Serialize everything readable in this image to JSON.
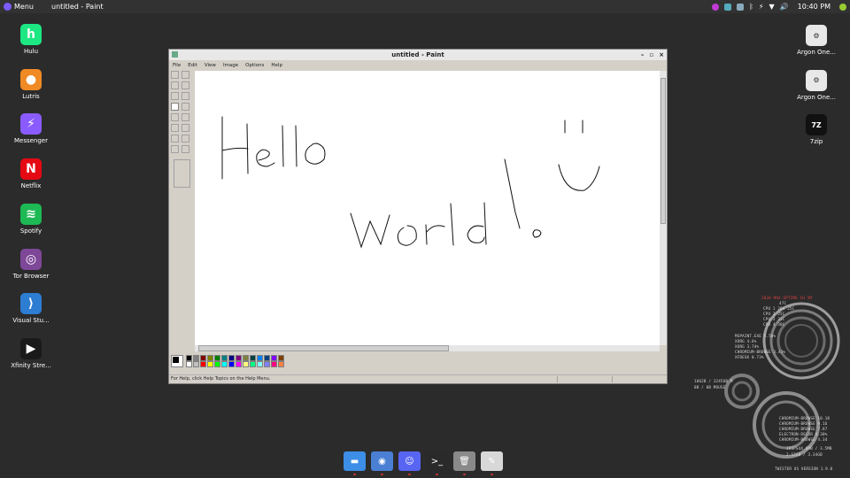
{
  "top_panel": {
    "menu_label": "Menu",
    "window_title": "untitled - Paint",
    "clock": "10:40 PM"
  },
  "desktop_left": [
    {
      "label": "Hulu",
      "icon": "hulu-icon",
      "color": "#1ce783",
      "glyph": "h"
    },
    {
      "label": "Lutris",
      "icon": "lutris-icon",
      "color": "#f08a24",
      "glyph": "●"
    },
    {
      "label": "Messenger",
      "icon": "messenger-icon",
      "color": "#8a5cff",
      "glyph": "⚡"
    },
    {
      "label": "Netflix",
      "icon": "netflix-icon",
      "color": "#e50914",
      "glyph": "N"
    },
    {
      "label": "Spotify",
      "icon": "spotify-icon",
      "color": "#1db954",
      "glyph": "≋"
    },
    {
      "label": "Tor Browser",
      "icon": "tor-icon",
      "color": "#7e4798",
      "glyph": "◎"
    },
    {
      "label": "Visual Stu...",
      "icon": "vscode-icon",
      "color": "#2d7dd2",
      "glyph": "⟩"
    },
    {
      "label": "Xfinity Stre...",
      "icon": "xfinity-icon",
      "color": "#1a1a1a",
      "glyph": "▶"
    }
  ],
  "desktop_right": [
    {
      "label": "Argon One...",
      "icon": "script-icon"
    },
    {
      "label": "Argon One...",
      "icon": "script-icon"
    },
    {
      "label": "7zip",
      "icon": "7zip-icon",
      "glyph": "7Z"
    }
  ],
  "paint": {
    "title": "untitled - Paint",
    "menus": [
      "File",
      "Edit",
      "View",
      "Image",
      "Options",
      "Help"
    ],
    "status_text": "For Help, click Help Topics on the Help Menu.",
    "palette_colors": [
      "#000000",
      "#808080",
      "#800000",
      "#808000",
      "#008000",
      "#008080",
      "#000080",
      "#800080",
      "#808040",
      "#004040",
      "#0080ff",
      "#004080",
      "#8000ff",
      "#804000",
      "#ffffff",
      "#c0c0c0",
      "#ff0000",
      "#ffff00",
      "#00ff00",
      "#00ffff",
      "#0000ff",
      "#ff00ff",
      "#ffff80",
      "#00ff80",
      "#80ffff",
      "#8080ff",
      "#ff0080",
      "#ff8040"
    ]
  },
  "conky": {
    "rows": [
      {
        "text": "2020  MAX  UPTIME 1H 5M",
        "accent": true
      },
      {
        "text": "   47C"
      },
      {
        "text": "CPU 1  26%   25C"
      },
      {
        "text": "CPU 2  25C"
      },
      {
        "text": "CPU 3  33C"
      },
      {
        "text": "CPU 4  30C"
      },
      {
        "text": "MSPAINT.EXE     5.56%"
      },
      {
        "text": "XORG            4.6%"
      },
      {
        "text": "XORG            3.74%"
      },
      {
        "text": "CHROMIUM-BROWSE 3.43%"
      },
      {
        "text": "XFDESK          0.73%"
      },
      {
        "text": "1062B / 32456B M"
      },
      {
        "text": "0B / 0B   MOUSE"
      },
      {
        "text": "CHROMIUM-BROWSE  10.18"
      },
      {
        "text": "CHROMIUM-BROWSE   9.16"
      },
      {
        "text": "CHROMIUM-BROWSE   7.87"
      },
      {
        "text": "ELECTRON-DECOR    6.30%"
      },
      {
        "text": "CHROMIUM-BROWSE   4.34"
      },
      {
        "text": "386PS44.0MB / 3.5MB"
      },
      {
        "text": "2.12GB / 3.34GB"
      },
      {
        "text": "TWISTER OS VERSION 1.9.0"
      }
    ]
  },
  "dock": [
    {
      "name": "files-icon",
      "color": "#3d8ee6",
      "glyph": "▬"
    },
    {
      "name": "chromium-icon",
      "color": "#4a7fd4",
      "glyph": "◉"
    },
    {
      "name": "discord-icon",
      "color": "#5865f2",
      "glyph": "☺"
    },
    {
      "name": "terminal-icon",
      "color": "#2a2a2a",
      "glyph": ">_"
    },
    {
      "name": "trash-icon",
      "color": "#8a8a8a",
      "glyph": "🗑"
    },
    {
      "name": "paint-icon",
      "color": "#d8d8d8",
      "glyph": "✎"
    }
  ]
}
